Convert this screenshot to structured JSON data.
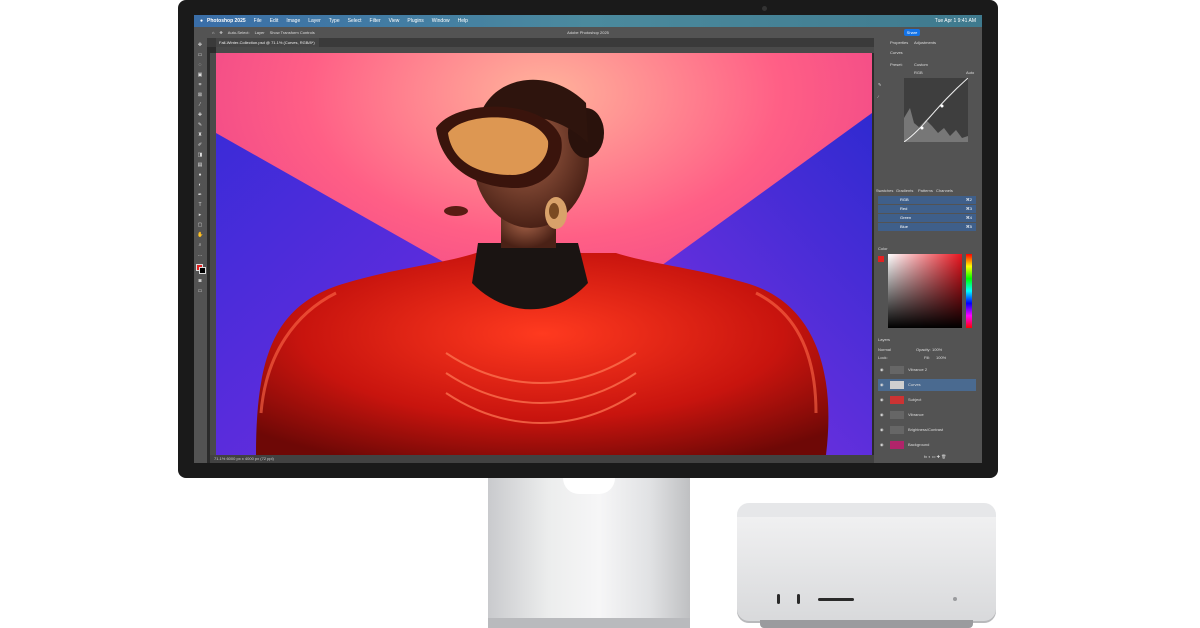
{
  "menubar": {
    "app": "Photoshop 2025",
    "items": [
      "File",
      "Edit",
      "Image",
      "Layer",
      "Type",
      "Select",
      "Filter",
      "View",
      "Plugins",
      "Window",
      "Help"
    ],
    "datetime": "Tue Apr 1  9:41 AM"
  },
  "window": {
    "title": "Adobe Photoshop 2025",
    "share_label": "Share"
  },
  "options_bar": {
    "auto_select": "Auto-Select:",
    "layer": "Layer",
    "show_transform": "Show Transform Controls"
  },
  "document": {
    "tab_label": "Fall-Winter-Collection.psd @ 71.1% (Curves, RGB/8*)",
    "status": "71.1%    6000 px x 4000 px (72 ppi)"
  },
  "properties": {
    "tabs": [
      "Properties",
      "Adjustments"
    ],
    "section": "Curves",
    "preset_label": "Preset:",
    "preset_value": "Custom",
    "channel": "RGB",
    "auto_label": "Auto"
  },
  "channels_panel": {
    "tabs": [
      "Swatches",
      "Gradients",
      "Patterns",
      "Channels"
    ],
    "channels": [
      {
        "name": "RGB",
        "key": "⌘2"
      },
      {
        "name": "Red",
        "key": "⌘3"
      },
      {
        "name": "Green",
        "key": "⌘4"
      },
      {
        "name": "Blue",
        "key": "⌘5"
      }
    ]
  },
  "color_panel": {
    "title": "Color"
  },
  "layers_panel": {
    "title": "Layers",
    "blend_mode": "Normal",
    "opacity_label": "Opacity:",
    "opacity": "100%",
    "lock_label": "Lock:",
    "fill_label": "Fill:",
    "fill": "100%",
    "layers": [
      {
        "name": "Vibrance 2"
      },
      {
        "name": "Curves"
      },
      {
        "name": "Subject"
      },
      {
        "name": "Vibrance"
      },
      {
        "name": "Brightness/Contrast"
      },
      {
        "name": "Background"
      }
    ]
  },
  "colors": {
    "accent": "#1473e6"
  }
}
